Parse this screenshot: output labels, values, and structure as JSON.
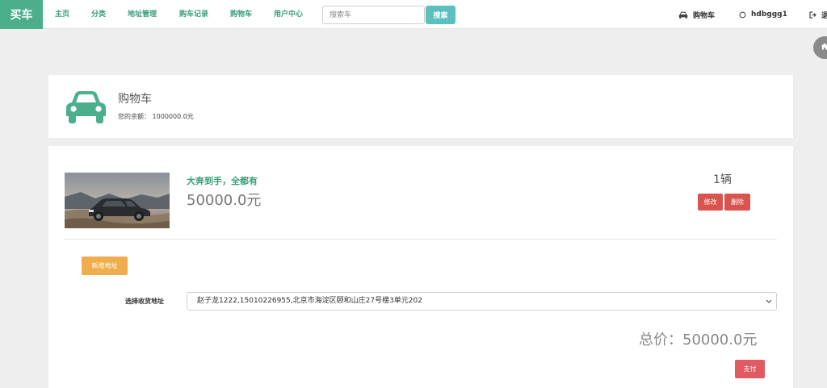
{
  "navbar": {
    "brand": "买车",
    "links": [
      "主页",
      "分类",
      "地址管理",
      "购车记录",
      "购物车",
      "用户中心"
    ],
    "search": {
      "placeholder": "搜索车",
      "value": ""
    },
    "search_button": "搜索",
    "cart_link": "购物车",
    "username": "hdbggg1",
    "logout_label": "退"
  },
  "header": {
    "title": "购物车",
    "balance_label": "您的余额：",
    "balance_value": "1000000.0元"
  },
  "cart": {
    "items": [
      {
        "title": "大奔到手，全都有",
        "price": "50000.0元",
        "quantity": "1辆",
        "edit_label": "修改",
        "delete_label": "删除"
      }
    ],
    "add_address_label": "新增地址",
    "address_label": "选择收货地址",
    "address_selected": "赵子龙1222,15010226955,北京市海淀区颐和山庄27号楼3单元202",
    "total_label": "总价：",
    "total_value": "50000.0元",
    "pay_label": "支付"
  },
  "colors": {
    "brand": "#4caf8c",
    "link": "#3aa077",
    "search_button": "#5bc0be",
    "danger": "#d9534f",
    "warning": "#f0ad4e"
  },
  "icons": [
    "car-icon",
    "user-icon",
    "logout-icon",
    "home-icon",
    "chevron-down-icon"
  ]
}
